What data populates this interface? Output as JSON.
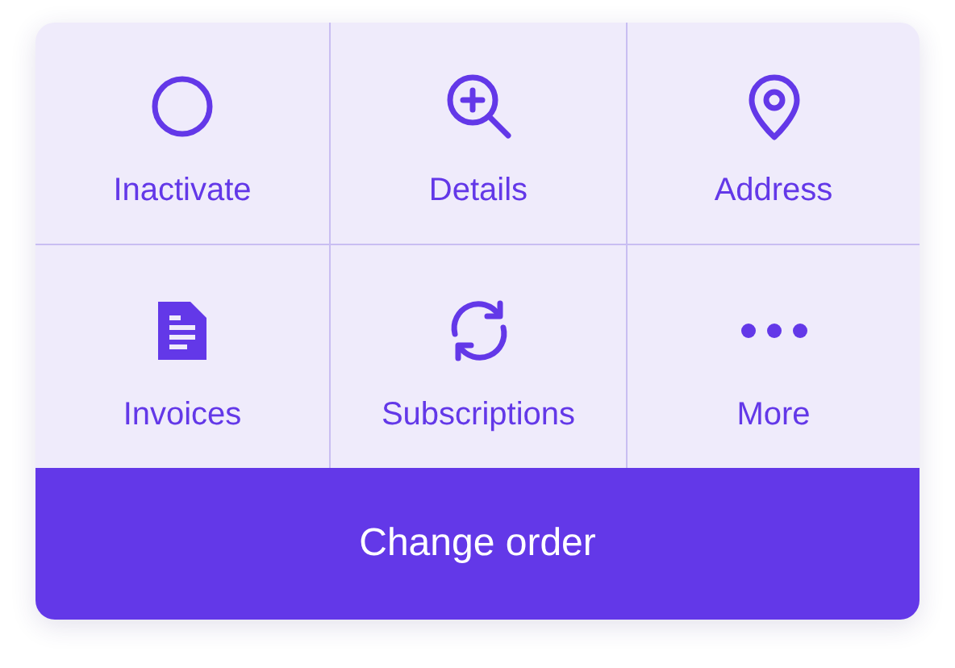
{
  "actions": [
    {
      "label": "Inactivate",
      "kind": "circle"
    },
    {
      "label": "Details",
      "kind": "zoom"
    },
    {
      "label": "Address",
      "kind": "pin"
    },
    {
      "label": "Invoices",
      "kind": "document"
    },
    {
      "label": "Subscriptions",
      "kind": "refresh"
    },
    {
      "label": "More",
      "kind": "dots"
    }
  ],
  "primary_button": {
    "label": "Change order"
  }
}
